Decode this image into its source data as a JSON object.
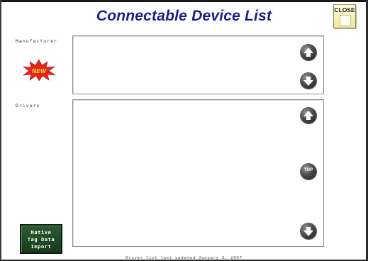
{
  "window": {
    "title": "Connectable Device List",
    "close_label": "CLOSE"
  },
  "manufacturer": {
    "label": "Manufacturer",
    "badge_text": "NEW",
    "items": []
  },
  "drivers": {
    "label": "Drivers",
    "top_button_label": "TOP",
    "items": []
  },
  "import_button": {
    "line1": "Native",
    "line2": "Tag Data",
    "line3": "Import"
  },
  "footer": {
    "note": "Driver list last updated January 3, 2007"
  },
  "colors": {
    "title": "#1c1c8e",
    "badge": "#e8231a",
    "import_button": "#1f4a25",
    "close_button": "#f4e79a"
  },
  "icons": {
    "scroll_up": "arrow-up-circle-icon",
    "scroll_down": "arrow-down-circle-icon",
    "scroll_top": "top-circle-icon",
    "close": "document-icon",
    "new": "starburst-icon"
  }
}
